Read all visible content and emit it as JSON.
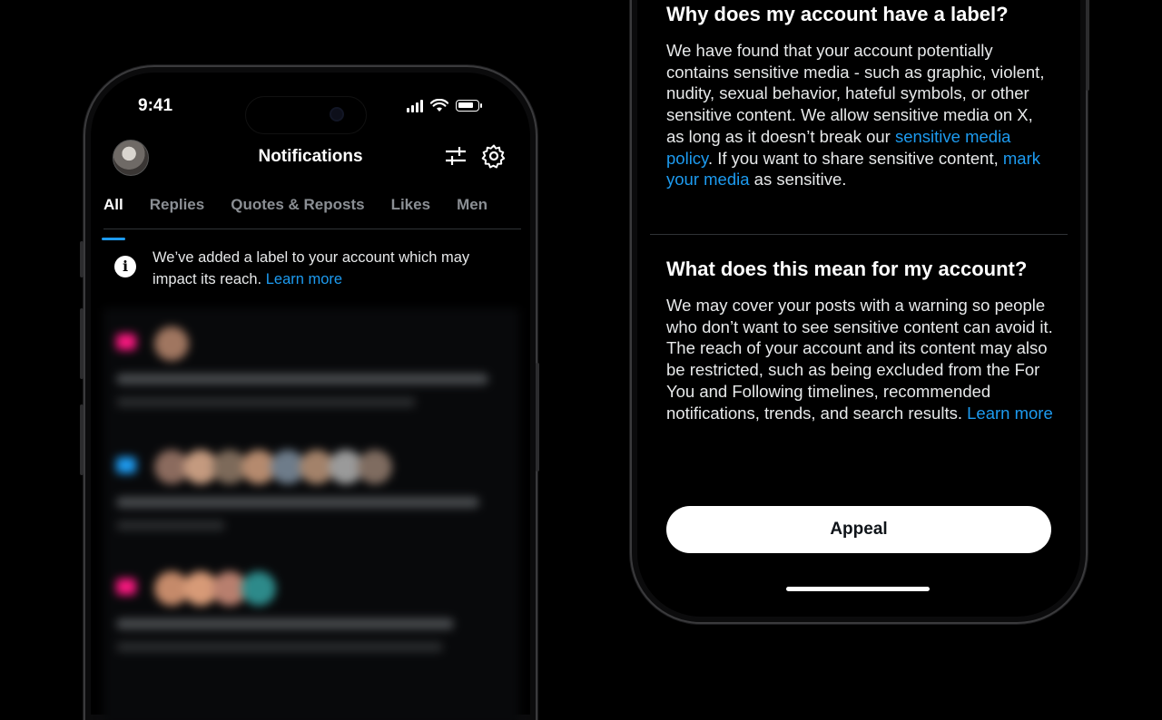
{
  "left_phone": {
    "status_time": "9:41",
    "header_title": "Notifications",
    "icons": {
      "avatar": "profile-avatar",
      "filter": "sliders-icon",
      "settings": "gear-icon",
      "info": "info-icon"
    },
    "tabs": [
      {
        "label": "All",
        "active": true
      },
      {
        "label": "Replies",
        "active": false
      },
      {
        "label": "Quotes & Reposts",
        "active": false
      },
      {
        "label": "Likes",
        "active": false
      },
      {
        "label": "Men",
        "active": false
      }
    ],
    "notice": {
      "text": "We’ve added a label to your account which may impact its reach.",
      "link": "Learn more"
    }
  },
  "right_phone": {
    "section1": {
      "heading": "Why does my account have a label?",
      "p_a": "We have found that your account potentially contains sensitive media - such as graphic, violent, nudity, sexual behavior, hateful symbols, or other sensitive content. We allow sensitive media on X, as long as it doesn’t break our ",
      "link1": "sensitive media policy",
      "p_b": ". If you want to share sensitive content, ",
      "link2": "mark your media",
      "p_c": " as sensitive."
    },
    "section2": {
      "heading": "What does this mean for my account?",
      "p_a": "We may cover your posts with a warning so people who don’t want to see sensitive content can avoid it. The reach of your account and its content may also be restricted, such as being excluded from the For You and Following timelines, recommended notifications, trends, and search results. ",
      "link": "Learn more"
    },
    "appeal_label": "Appeal"
  },
  "colors": {
    "background": "#000000",
    "link": "#1d9bf0",
    "text": "#e7e9ea",
    "button_bg": "#ffffff"
  }
}
